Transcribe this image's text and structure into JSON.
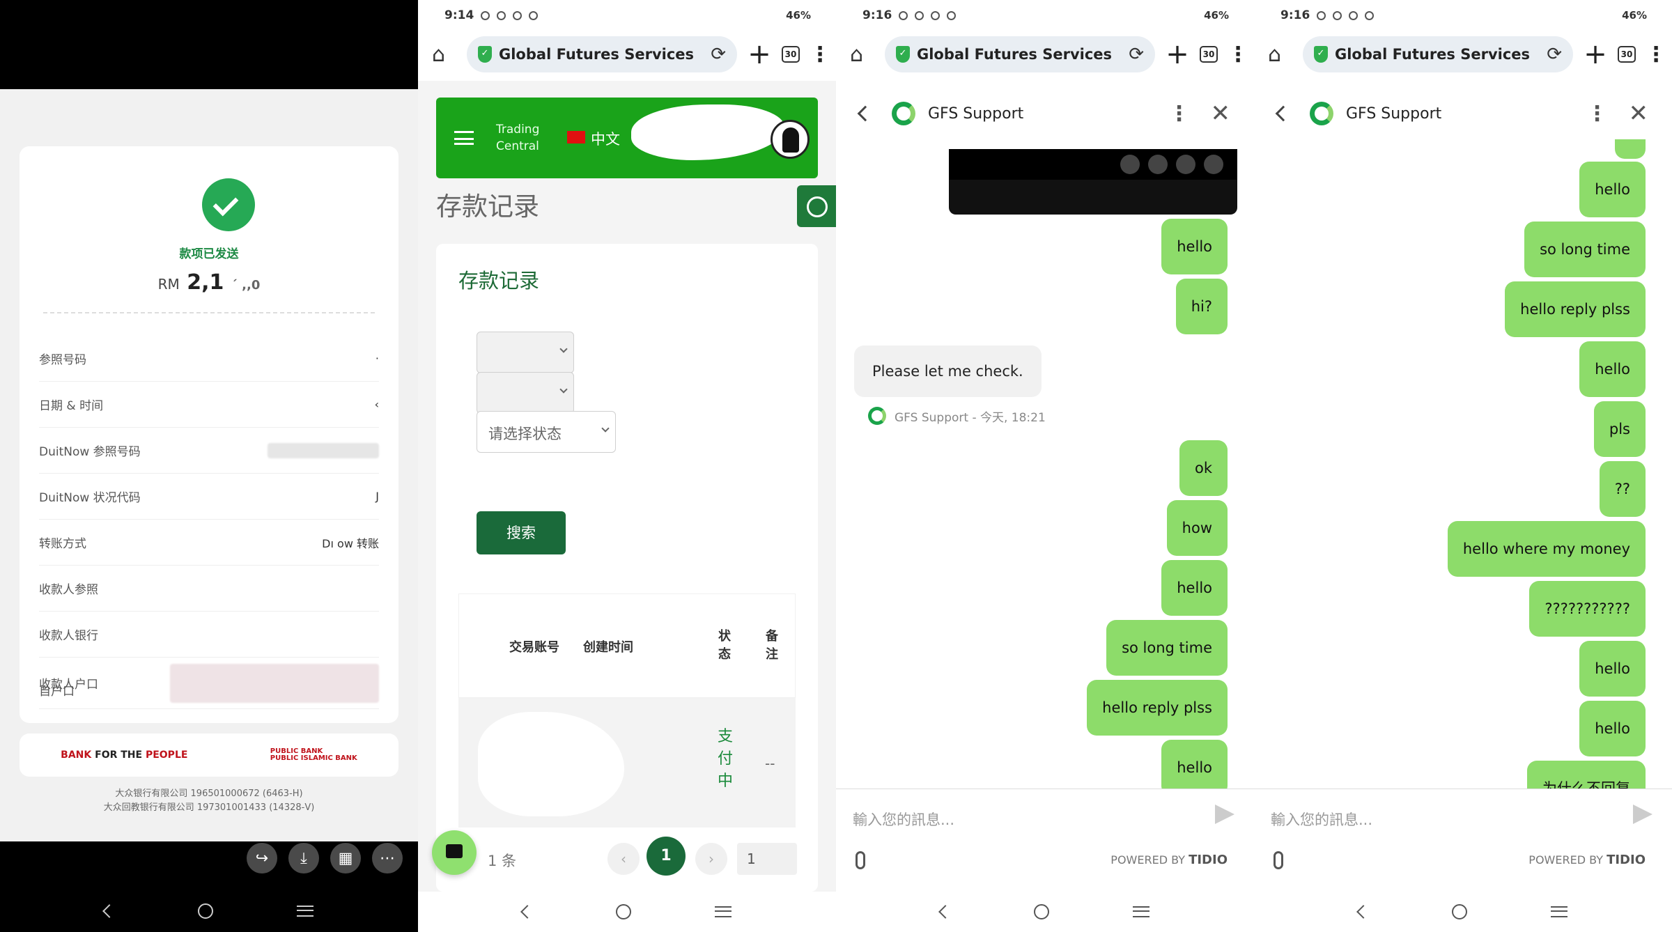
{
  "panel1": {
    "status_sent": "款项已发送",
    "amount_currency": "RM",
    "amount_value": "2,1",
    "amount_tail": "´ ,,0",
    "rows": [
      {
        "label": "参照号码",
        "value": "·"
      },
      {
        "label": "日期 & 时间",
        "value": "‹"
      },
      {
        "label": "DuitNow 参照号码",
        "value": ""
      },
      {
        "label": "DuitNow 状况代码",
        "value": "J"
      },
      {
        "label": "转账方式",
        "value": "Dı   ow 转账"
      },
      {
        "label": "收款人参照",
        "value": ""
      },
      {
        "label": "收款人银行",
        "value": ""
      },
      {
        "label": "收款人户口",
        "value": ""
      },
      {
        "label": "自户口",
        "value": ""
      }
    ],
    "bank_left_prefix": "BANK",
    "bank_left_mid": " FOR THE ",
    "bank_left_suffix": "PEOPLE",
    "bank_right_1": "PUBLIC BANK",
    "bank_right_2": "PUBLIC ISLAMIC BANK",
    "legal_1": "大众银行有限公司 196501000672 (6463-H)",
    "legal_2": "大众回教银行有限公司 197301001433 (14328-V)"
  },
  "browser": {
    "p2_time": "9:14",
    "chat_time": "9:16",
    "battery": "46%",
    "title": "Global Futures Services",
    "tab_count": "30"
  },
  "panel2": {
    "brand_1": "Trading",
    "brand_2": "Central",
    "language": "中文",
    "page_title": "存款记录",
    "card_title": "存款记录",
    "status_placeholder": "请选择状态",
    "search_label": "搜索",
    "col_account": "交易账号",
    "col_created": "创建时间",
    "col_status": "状态",
    "col_note": "备注",
    "row_status": "支付中",
    "row_note": "--",
    "total": "1 条",
    "current_page": "1",
    "page_input": "1"
  },
  "chat": {
    "agent_name": "GFS Support",
    "placeholder": "輸入您的訊息...",
    "powered_by": "POWERED BY",
    "powered_brand": "TIDIO",
    "p3_messages": [
      "hello",
      "hi?"
    ],
    "agent_reply": "Please let me check.",
    "agent_meta": "GFS Support - 今天, 18:21",
    "p3_messages_after": [
      "ok",
      "how",
      "hello",
      "so long time",
      "hello reply plss",
      "hello"
    ],
    "p4_messages": [
      "hello",
      "so long time",
      "hello reply plss",
      "hello",
      "pls",
      "??",
      "hello where my money",
      "???????????",
      "hello",
      "hello",
      "为什么不回复"
    ]
  },
  "colors": {
    "brand_green": "#1aa31a",
    "dark_green": "#1a6a3a",
    "bubble_green": "#8ddc6a"
  }
}
